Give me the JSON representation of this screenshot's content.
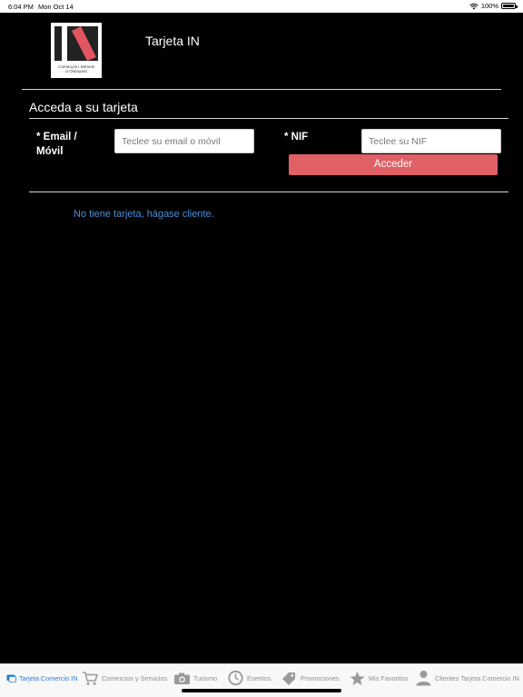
{
  "status_bar": {
    "time": "6:04 PM",
    "date": "Mon Oct 14",
    "battery": "100%"
  },
  "header": {
    "logo_caption_line1": "Comerços i Serveis",
    "logo_caption_line2": "a Ontinyent",
    "app_title": "Tarjeta IN"
  },
  "login": {
    "heading": "Acceda a su tarjeta",
    "email_label_line1": "* Email /",
    "email_label_line2": "Móvil",
    "email_placeholder": "Teclee su email o móvil",
    "nif_label": "* NIF",
    "nif_placeholder": "Teclee su NIF",
    "submit_label": "Acceder",
    "signup_link": "No tiene tarjeta, hágase cliente."
  },
  "colors": {
    "accent": "#e06066",
    "link": "#4a90d9",
    "active_tab": "#2b7bd8",
    "inactive_tab": "#8e8e8e"
  },
  "tabs": [
    {
      "label": "Tarjeta Comercio IN",
      "icon": "card-icon",
      "active": true
    },
    {
      "label": "Comercios y Servicios",
      "icon": "cart-icon",
      "active": false
    },
    {
      "label": "Turismo",
      "icon": "camera-icon",
      "active": false
    },
    {
      "label": "Eventos",
      "icon": "clock-icon",
      "active": false
    },
    {
      "label": "Promociones",
      "icon": "tag-icon",
      "active": false
    },
    {
      "label": "Mis Favoritos",
      "icon": "star-icon",
      "active": false
    },
    {
      "label": "Clientes Tarjeta Comercio IN",
      "icon": "person-icon",
      "active": false
    }
  ]
}
